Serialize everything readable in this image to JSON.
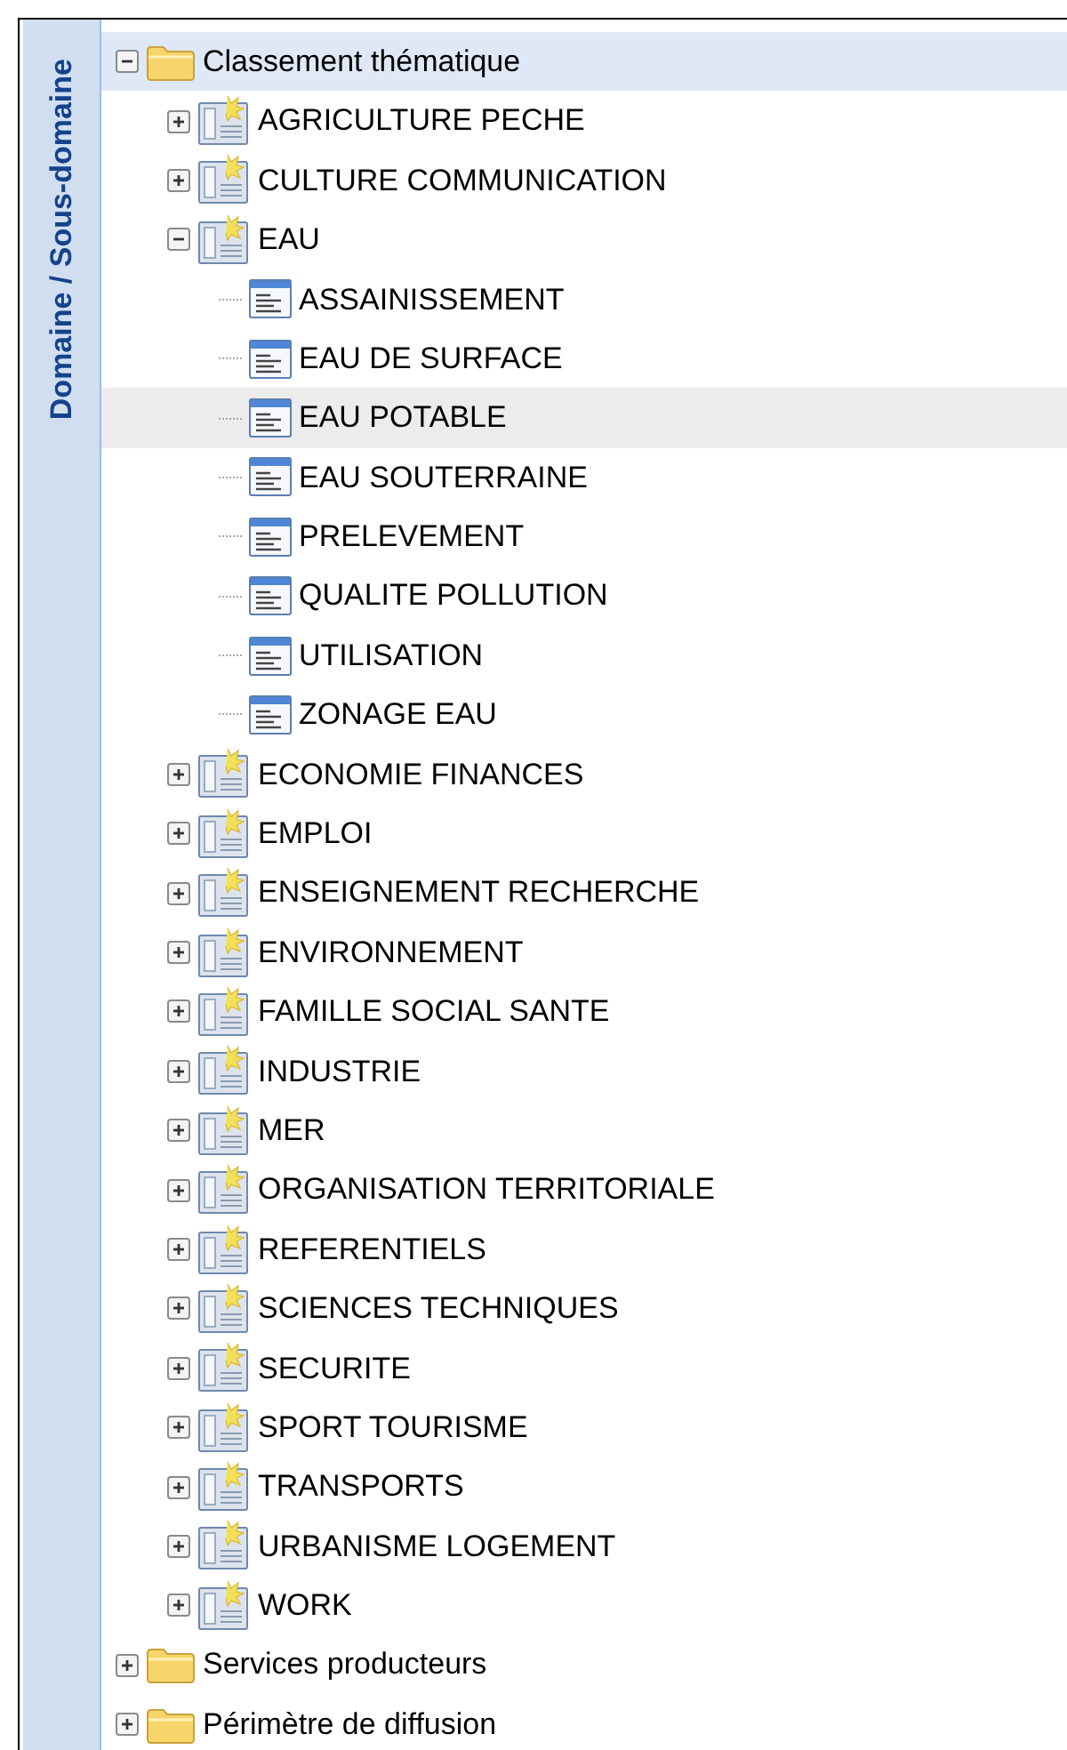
{
  "side_tab": {
    "label": "Domaine / Sous-domaine"
  },
  "tree": [
    {
      "kind": "folder",
      "label": "Classement thématique",
      "expanded": true,
      "selected": true,
      "hovered": false,
      "children": [
        {
          "kind": "domain",
          "label": "AGRICULTURE PECHE",
          "expanded": false,
          "selected": false,
          "hovered": false
        },
        {
          "kind": "domain",
          "label": "CULTURE COMMUNICATION",
          "expanded": false,
          "selected": false,
          "hovered": false
        },
        {
          "kind": "domain",
          "label": "EAU",
          "expanded": true,
          "selected": false,
          "hovered": false,
          "children": [
            {
              "kind": "subdomain",
              "label": "ASSAINISSEMENT",
              "selected": false,
              "hovered": false
            },
            {
              "kind": "subdomain",
              "label": "EAU DE SURFACE",
              "selected": false,
              "hovered": false
            },
            {
              "kind": "subdomain",
              "label": "EAU POTABLE",
              "selected": false,
              "hovered": true
            },
            {
              "kind": "subdomain",
              "label": "EAU SOUTERRAINE",
              "selected": false,
              "hovered": false
            },
            {
              "kind": "subdomain",
              "label": "PRELEVEMENT",
              "selected": false,
              "hovered": false
            },
            {
              "kind": "subdomain",
              "label": "QUALITE POLLUTION",
              "selected": false,
              "hovered": false
            },
            {
              "kind": "subdomain",
              "label": "UTILISATION",
              "selected": false,
              "hovered": false
            },
            {
              "kind": "subdomain",
              "label": "ZONAGE EAU",
              "selected": false,
              "hovered": false
            }
          ]
        },
        {
          "kind": "domain",
          "label": "ECONOMIE FINANCES",
          "expanded": false,
          "selected": false,
          "hovered": false
        },
        {
          "kind": "domain",
          "label": "EMPLOI",
          "expanded": false,
          "selected": false,
          "hovered": false
        },
        {
          "kind": "domain",
          "label": "ENSEIGNEMENT RECHERCHE",
          "expanded": false,
          "selected": false,
          "hovered": false
        },
        {
          "kind": "domain",
          "label": "ENVIRONNEMENT",
          "expanded": false,
          "selected": false,
          "hovered": false
        },
        {
          "kind": "domain",
          "label": "FAMILLE SOCIAL SANTE",
          "expanded": false,
          "selected": false,
          "hovered": false
        },
        {
          "kind": "domain",
          "label": "INDUSTRIE",
          "expanded": false,
          "selected": false,
          "hovered": false
        },
        {
          "kind": "domain",
          "label": "MER",
          "expanded": false,
          "selected": false,
          "hovered": false
        },
        {
          "kind": "domain",
          "label": "ORGANISATION TERRITORIALE",
          "expanded": false,
          "selected": false,
          "hovered": false
        },
        {
          "kind": "domain",
          "label": "REFERENTIELS",
          "expanded": false,
          "selected": false,
          "hovered": false
        },
        {
          "kind": "domain",
          "label": "SCIENCES TECHNIQUES",
          "expanded": false,
          "selected": false,
          "hovered": false
        },
        {
          "kind": "domain",
          "label": "SECURITE",
          "expanded": false,
          "selected": false,
          "hovered": false
        },
        {
          "kind": "domain",
          "label": "SPORT TOURISME",
          "expanded": false,
          "selected": false,
          "hovered": false
        },
        {
          "kind": "domain",
          "label": "TRANSPORTS",
          "expanded": false,
          "selected": false,
          "hovered": false
        },
        {
          "kind": "domain",
          "label": "URBANISME LOGEMENT",
          "expanded": false,
          "selected": false,
          "hovered": false
        },
        {
          "kind": "domain",
          "label": "WORK",
          "expanded": false,
          "selected": false,
          "hovered": false
        }
      ]
    },
    {
      "kind": "folder",
      "label": "Services producteurs",
      "expanded": false,
      "selected": false,
      "hovered": false
    },
    {
      "kind": "folder",
      "label": "Périmètre de diffusion",
      "expanded": false,
      "selected": false,
      "hovered": false
    }
  ]
}
